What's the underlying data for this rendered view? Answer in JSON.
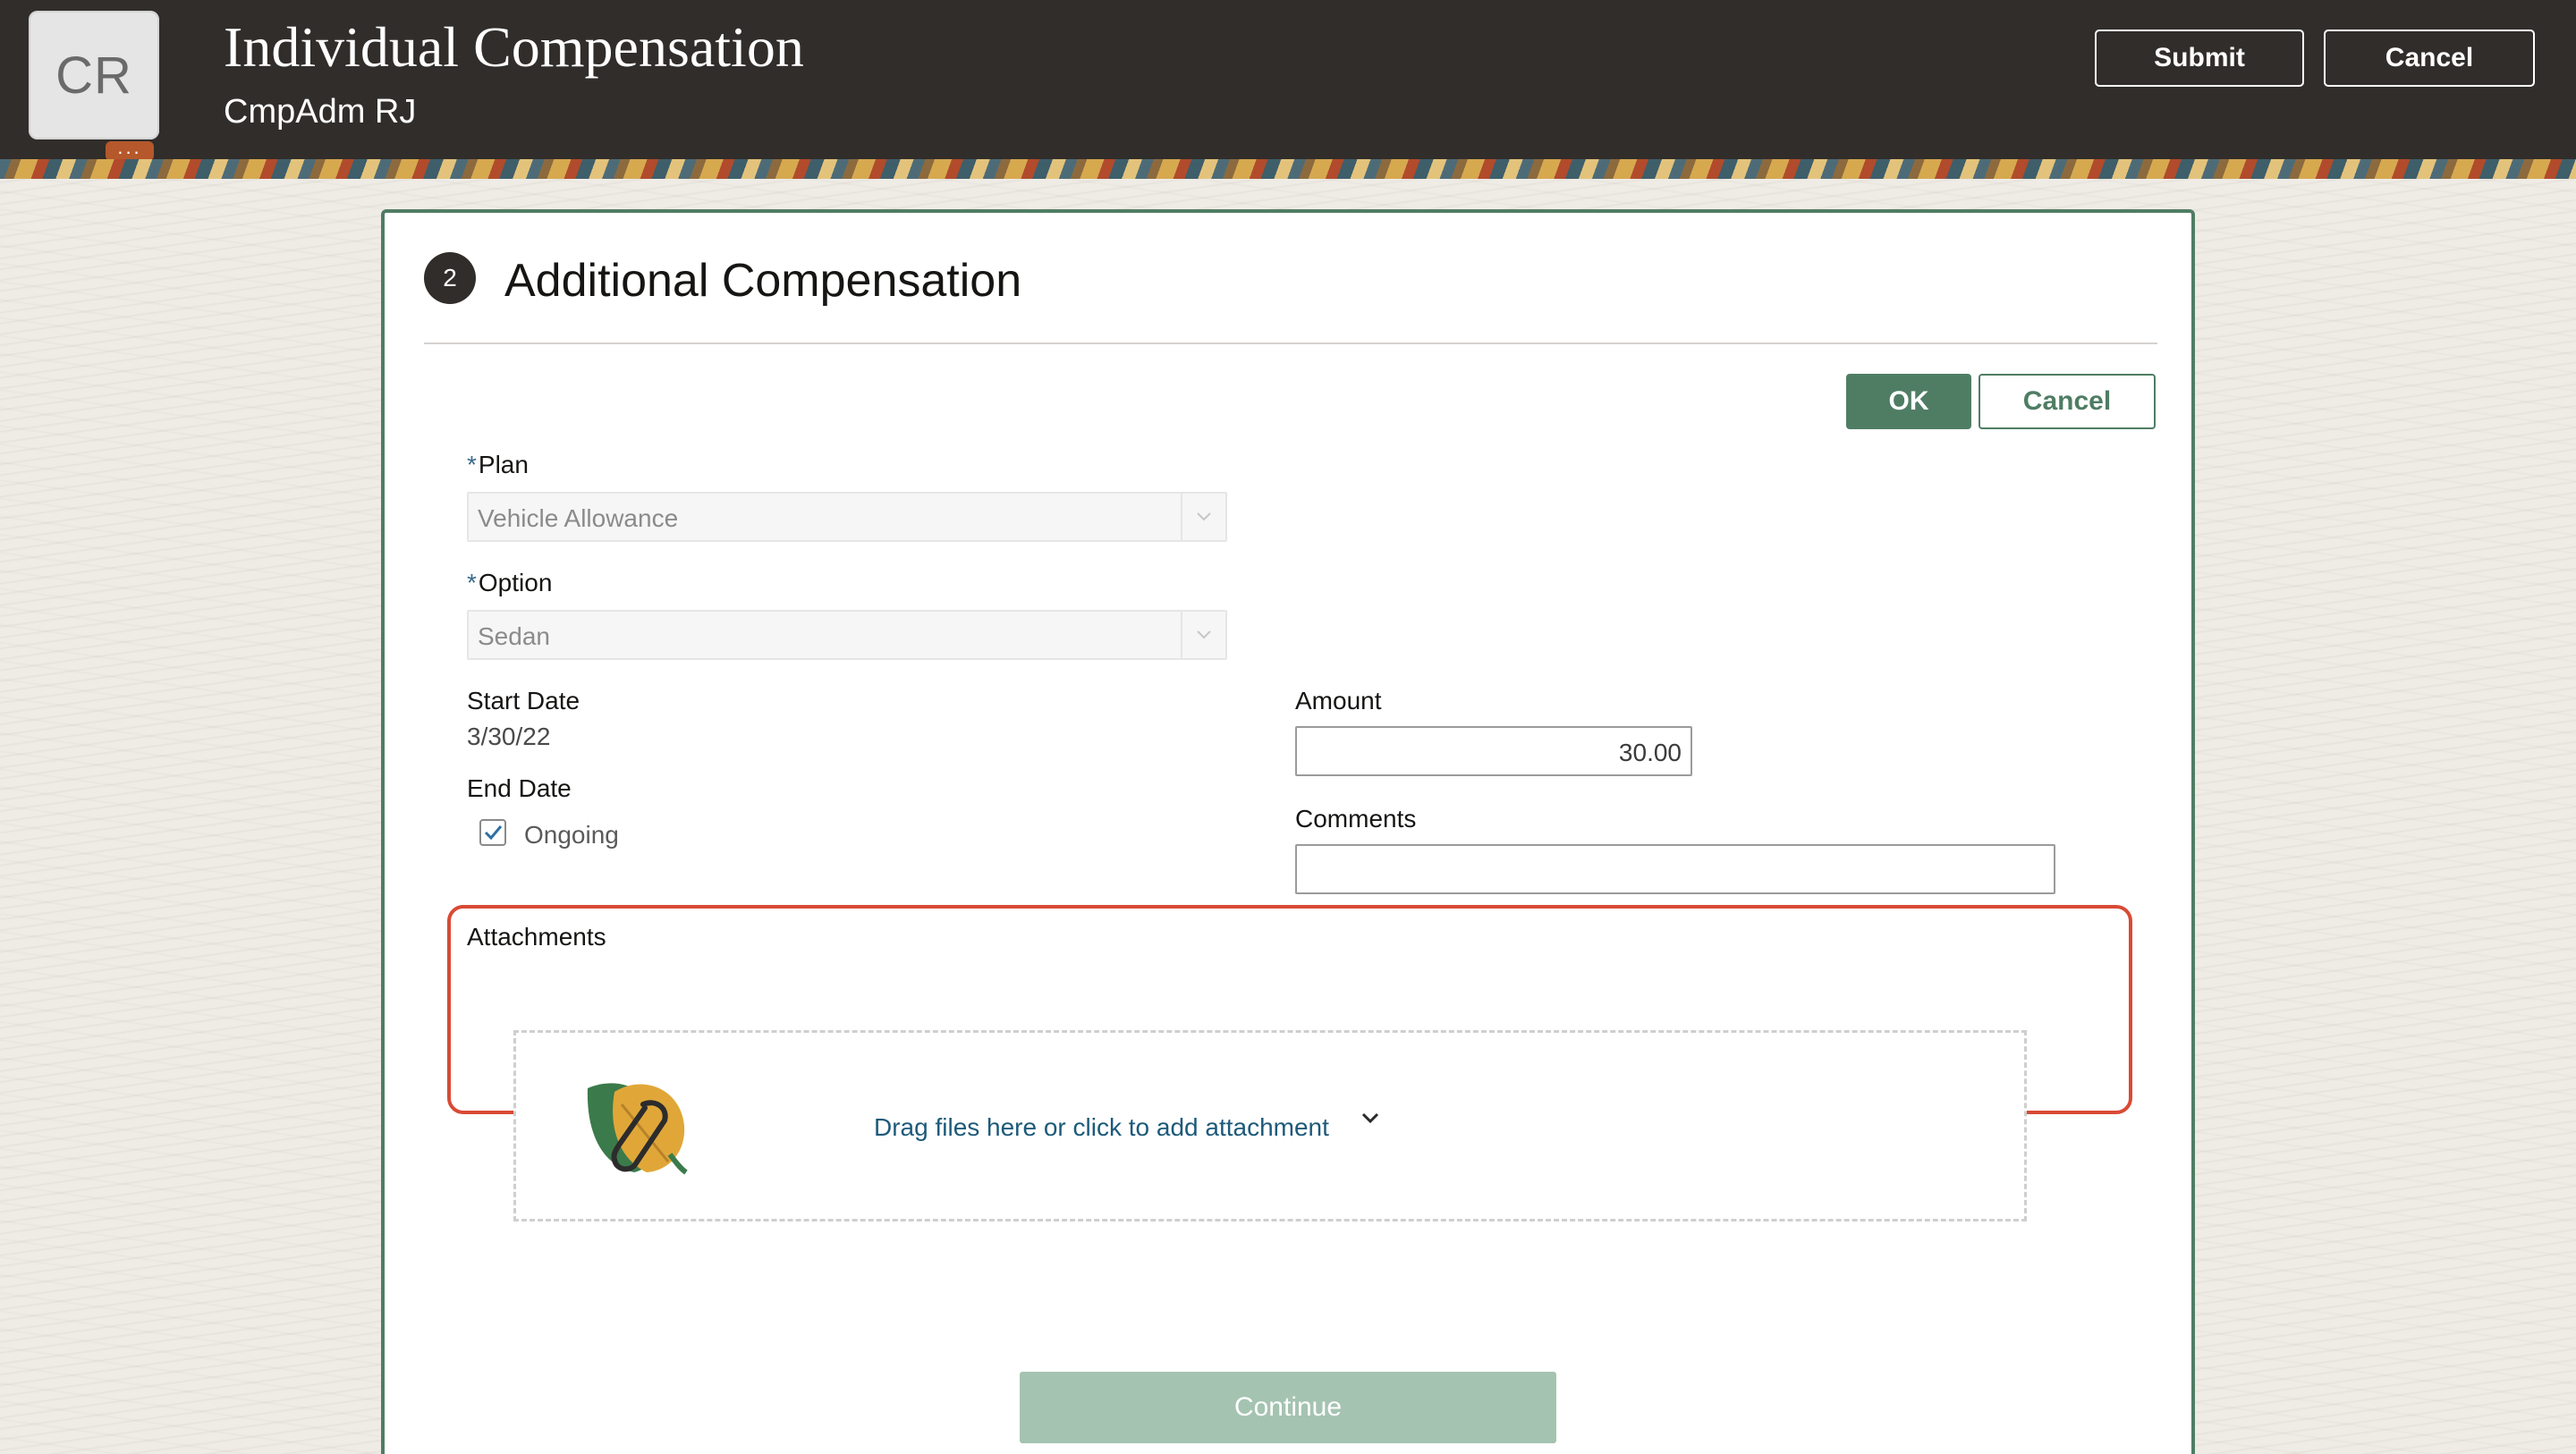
{
  "header": {
    "avatar_initials": "CR",
    "title": "Individual Compensation",
    "subtitle": "CmpAdm RJ",
    "submit_label": "Submit",
    "cancel_label": "Cancel"
  },
  "section": {
    "step_number": "2",
    "title": "Additional Compensation",
    "ok_label": "OK",
    "cancel_label": "Cancel"
  },
  "form": {
    "plan_label": "Plan",
    "plan_value": "Vehicle Allowance",
    "option_label": "Option",
    "option_value": "Sedan",
    "start_date_label": "Start Date",
    "start_date_value": "3/30/22",
    "end_date_label": "End Date",
    "ongoing_label": "Ongoing",
    "ongoing_checked": true,
    "amount_label": "Amount",
    "amount_value": "30.00",
    "comments_label": "Comments",
    "comments_value": "",
    "required_marker": "*"
  },
  "attachments": {
    "label": "Attachments",
    "drop_text": "Drag files here or click to add attachment"
  },
  "footer": {
    "continue_label": "Continue"
  },
  "colors": {
    "header_bg": "#312d2a",
    "accent_green": "#4f7d64",
    "highlight_red": "#d94a35",
    "link_blue": "#1d5a7a"
  }
}
